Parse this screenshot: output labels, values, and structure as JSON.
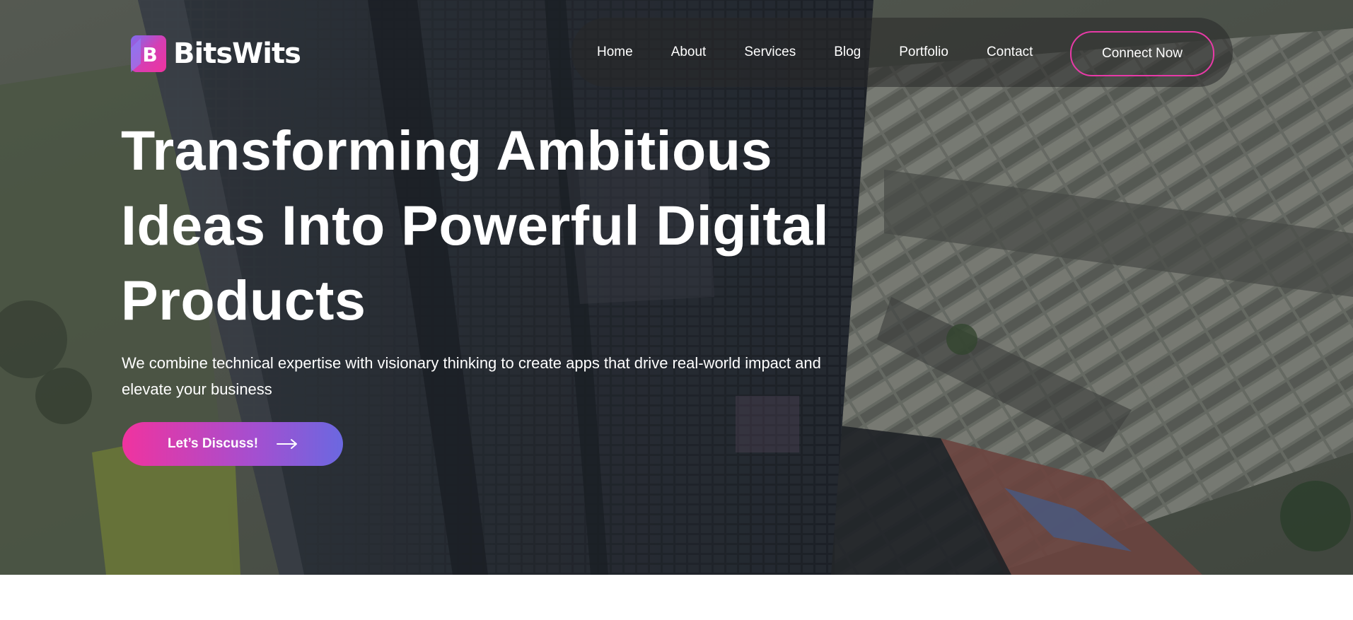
{
  "brand": {
    "name": "BitsWits",
    "logo_letter": "B"
  },
  "nav": {
    "links": [
      "Home",
      "About",
      "Services",
      "Blog",
      "Portfolio",
      "Contact"
    ],
    "connect_label": "Connect Now"
  },
  "hero": {
    "headline_lines": [
      "Transforming Ambitious",
      "Ideas Into Powerful Digital",
      "Products"
    ],
    "subtext": "We combine technical expertise with visionary thinking to create apps that drive real-world impact and elevate your business",
    "cta_label": "Let’s Discuss!",
    "cta_icon": "arrow-right-icon"
  },
  "colors": {
    "accent_pink": "#f0339f",
    "accent_purple": "#6b68e0",
    "connect_border": "#e83aa7",
    "nav_bg": "rgba(40,40,40,0.55)"
  }
}
